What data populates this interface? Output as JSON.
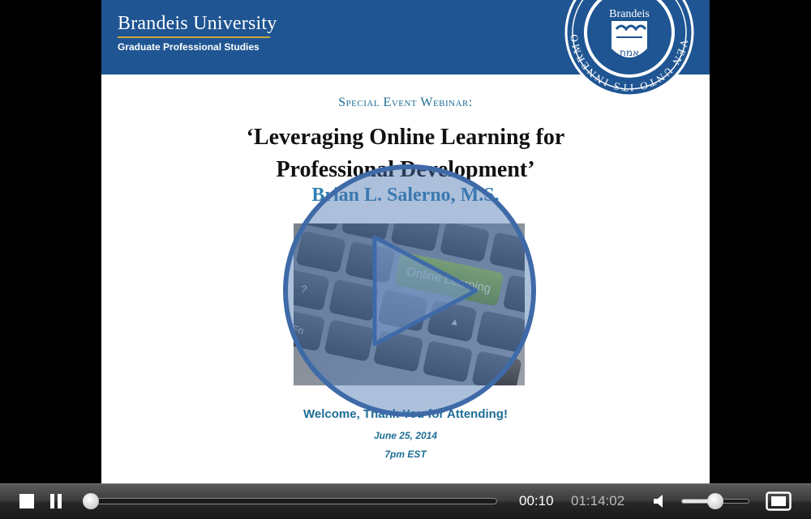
{
  "slide": {
    "brand_name": "Brandeis University",
    "brand_subtitle": "Graduate Professional Studies",
    "seal": {
      "label": "Brandeis",
      "motto": "אמת",
      "ring_text": "VEN UNTO ITS INNERMOST PARTS"
    },
    "kicker": "Special Event Webinar:",
    "title_line1": "‘Leveraging Online Learning for",
    "title_line2": "Professional Development’",
    "presenter": "Brian L. Salerno, M.S.",
    "image": {
      "key_label": "Online Learning",
      "fn_label": "Fn"
    },
    "welcome": "Welcome, Thank You for Attending!",
    "date": "June 25, 2014",
    "time": "7pm EST"
  },
  "colors": {
    "banner": "#1f5592",
    "accent_blue": "#1e6d96",
    "presenter_blue": "#2f7fb0",
    "play_overlay": "#4a73b0",
    "key_green": "#7fa33a"
  },
  "controls": {
    "play_icon": "play-icon",
    "stop_icon": "stop-icon",
    "pause_icon": "pause-icon",
    "volume_icon": "speaker-icon",
    "fullscreen_icon": "fullscreen-icon",
    "current_time": "00:10",
    "total_time": "01:14:02",
    "progress_fraction": 0.002,
    "volume_fraction": 0.5
  }
}
